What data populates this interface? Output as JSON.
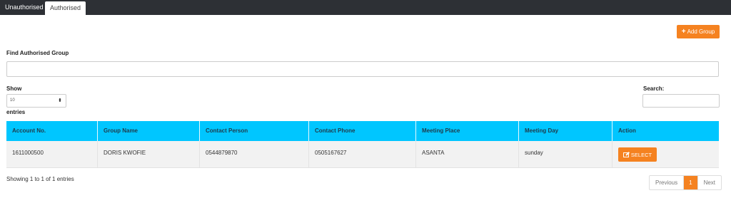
{
  "tabs": [
    {
      "label": "Unauthorised",
      "active": false
    },
    {
      "label": "Authorised",
      "active": true
    }
  ],
  "toolbar": {
    "add_group_label": "Add Group",
    "add_icon": "plus-icon"
  },
  "find": {
    "label": "Find Authorised Group",
    "value": ""
  },
  "length": {
    "show_label": "Show",
    "value": "10",
    "entries_label": "entries"
  },
  "search": {
    "label": "Search:",
    "value": ""
  },
  "table": {
    "headers": [
      "Account No.",
      "Group Name",
      "Contact Person",
      "Contact Phone",
      "Meeting Place",
      "Meeting Day",
      "Action"
    ],
    "rows": [
      {
        "account_no": "1611000500",
        "group_name": "DORIS KWOFIE",
        "contact_person": "0544879870",
        "contact_phone": "0505167627",
        "meeting_place": "ASANTA",
        "meeting_day": "sunday",
        "action_label": "SELECT"
      }
    ]
  },
  "footer": {
    "info": "Showing 1 to 1 of 1 entries",
    "pagination": {
      "previous": "Previous",
      "current": "1",
      "next": "Next"
    }
  },
  "colors": {
    "accent": "#f58220",
    "header_bg": "#00c6ff",
    "topbar": "#2d3035"
  }
}
